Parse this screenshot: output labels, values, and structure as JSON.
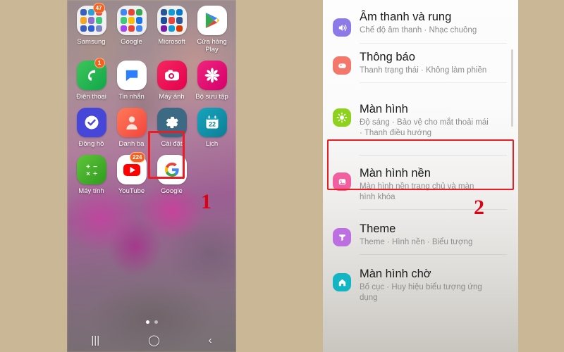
{
  "background_color": "#c9b795",
  "accent_highlight_color": "#ec1c24",
  "annotations": [
    {
      "label": "1",
      "name": "step-1-annotation"
    },
    {
      "label": "2",
      "name": "step-2-annotation"
    }
  ],
  "left_screen": {
    "app_rows": [
      [
        {
          "label": "Samsung",
          "icon": "samsung-folder-icon",
          "badge": "47",
          "type": "folder",
          "mini_colors": [
            "#3b5fc0",
            "#2f9fd6",
            "#e8453c",
            "#f5a623",
            "#8e6fd0",
            "#3ec97a",
            "#3b5fc0",
            "#2f5fd6",
            "#7a86c8"
          ]
        },
        {
          "label": "Google",
          "icon": "google-folder-icon",
          "badge": "",
          "type": "folder",
          "mini_colors": [
            "#4285f4",
            "#ea4335",
            "#34a853",
            "#3ec97a",
            "#fbbc05",
            "#1a73e8",
            "#a142f4",
            "#ea4335",
            "#4285f4"
          ]
        },
        {
          "label": "Microsoft",
          "icon": "microsoft-folder-icon",
          "badge": "",
          "type": "folder",
          "mini_colors": [
            "#2b579a",
            "#0f9bd7",
            "#0078d4",
            "#1b4f99",
            "#e8453c",
            "#2b579a",
            "#7719aa",
            "#0f9bd7",
            "#d83b01"
          ]
        },
        {
          "label": "Cửa hàng Play",
          "icon": "google-play-icon",
          "badge": "",
          "type": "play"
        }
      ],
      [
        {
          "label": "Điện thoại",
          "icon": "phone-icon",
          "badge": "1",
          "type": "phone"
        },
        {
          "label": "Tin nhắn",
          "icon": "messages-icon",
          "badge": "",
          "type": "messages"
        },
        {
          "label": "Máy ảnh",
          "icon": "camera-icon",
          "badge": "",
          "type": "camera"
        },
        {
          "label": "Bộ sưu tập",
          "icon": "gallery-icon",
          "badge": "",
          "type": "gallery"
        }
      ],
      [
        {
          "label": "Đồng hồ",
          "icon": "clock-icon",
          "badge": "",
          "type": "clock"
        },
        {
          "label": "Danh bạ",
          "icon": "contacts-icon",
          "badge": "",
          "type": "contacts"
        },
        {
          "label": "Cài đặt",
          "icon": "settings-gear-icon",
          "badge": "",
          "type": "settings"
        },
        {
          "label": "Lịch",
          "icon": "calendar-icon",
          "badge": "",
          "type": "calendar",
          "day": "22"
        }
      ],
      [
        {
          "label": "Máy tính",
          "icon": "calculator-icon",
          "badge": "",
          "type": "calculator"
        },
        {
          "label": "YouTube",
          "icon": "youtube-icon",
          "badge": "224",
          "type": "youtube"
        },
        {
          "label": "Google",
          "icon": "google-icon",
          "badge": "",
          "type": "google"
        },
        {
          "label": "",
          "icon": "",
          "badge": "",
          "type": "empty"
        }
      ]
    ],
    "page_dots": {
      "count": 2,
      "active_index": 0
    },
    "nav_bar": [
      {
        "name": "recents-button",
        "glyph": "|||"
      },
      {
        "name": "home-button",
        "glyph": "◯"
      },
      {
        "name": "back-button",
        "glyph": "‹"
      }
    ]
  },
  "right_screen": {
    "items": [
      {
        "title": "Âm thanh và rung",
        "subtitle": "Chế độ âm thanh  ·  Nhạc chuông",
        "icon": "sound-vibration-icon",
        "icon_color": "#8b7ae8",
        "highlighted": false
      },
      {
        "title": "Thông báo",
        "subtitle": "Thanh trạng thái  ·  Không làm phiền",
        "icon": "notifications-icon",
        "icon_color": "#f4776b",
        "highlighted": false
      },
      {
        "title": "Màn hình",
        "subtitle": "Độ sáng  ·  Bảo vệ cho mắt thoải mái  ·  Thanh điều hướng",
        "icon": "display-brightness-icon",
        "icon_color": "#8ed11f",
        "highlighted": true
      },
      {
        "title": "Màn hình nền",
        "subtitle": "Màn hình nền trang chủ và màn hình khóa",
        "icon": "wallpaper-image-icon",
        "icon_color": "#f25fa0",
        "highlighted": false
      },
      {
        "title": "Theme",
        "subtitle": "Theme  ·  Hình nền  ·  Biểu tượng",
        "icon": "theme-brush-icon",
        "icon_color": "#bb6fe0",
        "highlighted": false
      },
      {
        "title": "Màn hình chờ",
        "subtitle": "Bố cục  ·  Huy hiệu biểu tượng ứng dụng",
        "icon": "home-screen-icon",
        "icon_color": "#12b5c4",
        "highlighted": false
      }
    ]
  }
}
